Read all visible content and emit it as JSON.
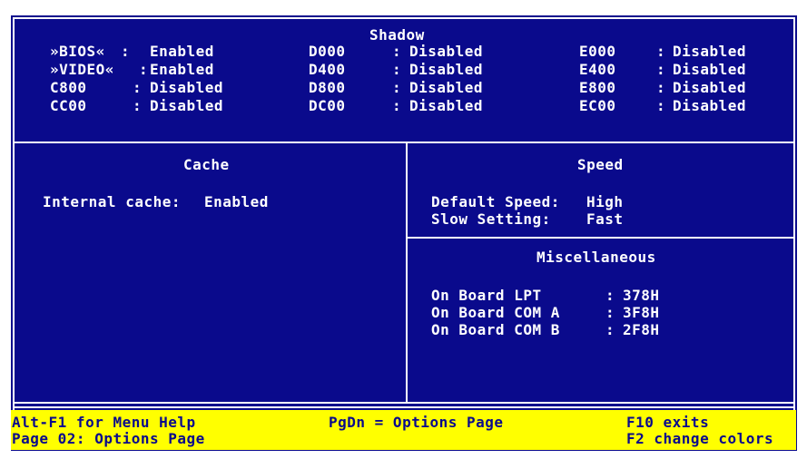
{
  "shadow": {
    "title": "Shadow",
    "col1": [
      {
        "key": "»BIOS« ",
        "sep": ":",
        "value": "Enabled"
      },
      {
        "key": "»VIDEO«",
        "sep": ":",
        "value": "Enabled"
      },
      {
        "key": "C800   ",
        "sep": ":",
        "value": "Disabled"
      },
      {
        "key": "CC00   ",
        "sep": ":",
        "value": "Disabled"
      }
    ],
    "col2": [
      {
        "key": "D000",
        "sep": ":",
        "value": "Disabled"
      },
      {
        "key": "D400",
        "sep": ":",
        "value": "Disabled"
      },
      {
        "key": "D800",
        "sep": ":",
        "value": "Disabled"
      },
      {
        "key": "DC00",
        "sep": ":",
        "value": "Disabled"
      }
    ],
    "col3": [
      {
        "key": "E000",
        "sep": ":",
        "value": "Disabled"
      },
      {
        "key": "E400",
        "sep": ":",
        "value": "Disabled"
      },
      {
        "key": "E800",
        "sep": ":",
        "value": "Disabled"
      },
      {
        "key": "EC00",
        "sep": ":",
        "value": "Disabled"
      }
    ]
  },
  "cache": {
    "title": "Cache",
    "label": "Internal cache:",
    "value": "Enabled"
  },
  "speed": {
    "title": "Speed",
    "default_label": "Default Speed:",
    "default_value": "High",
    "slow_label": "Slow Setting:",
    "slow_value": "Fast"
  },
  "misc": {
    "title": "Miscellaneous",
    "items": [
      {
        "label": "On Board LPT",
        "sep": ":",
        "value": "378H"
      },
      {
        "label": "On Board COM A",
        "sep": ":",
        "value": "3F8H"
      },
      {
        "label": "On Board COM B",
        "sep": ":",
        "value": "2F8H"
      }
    ]
  },
  "footer": {
    "menu_help": "Alt-F1 for Menu Help",
    "page": "Page 02: Options Page",
    "pgdn": "PgDn = Options Page",
    "exit": "F10 exits",
    "colors": "F2 change colors"
  },
  "colors": {
    "background": "#0a0a8c",
    "text": "#ffffff",
    "footer_bg": "#ffff00"
  }
}
